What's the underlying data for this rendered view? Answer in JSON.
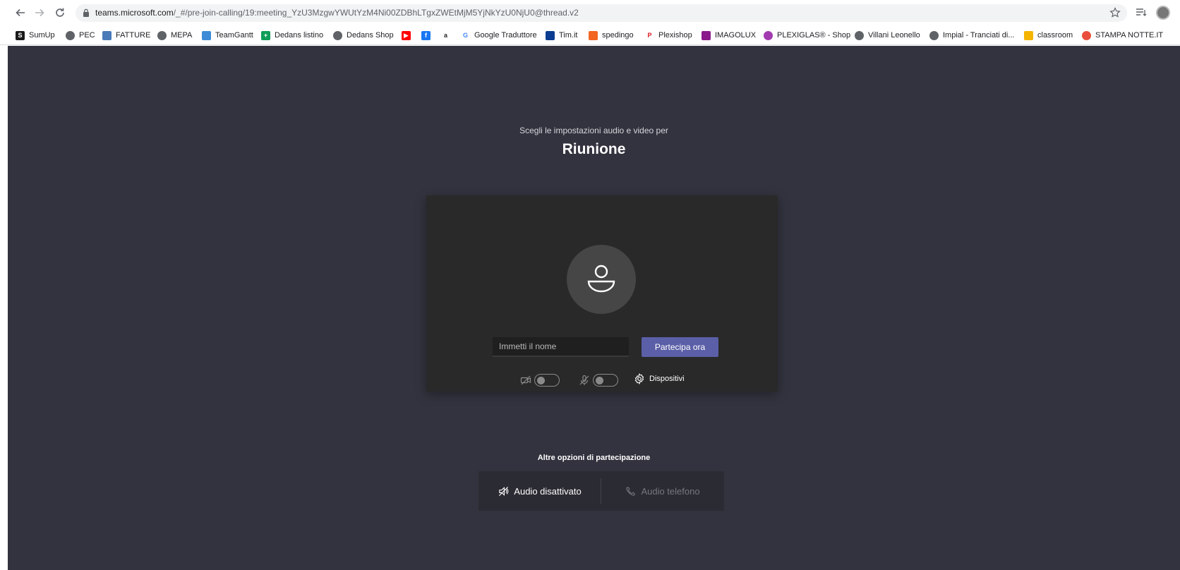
{
  "browser": {
    "url_host": "teams.microsoft.com",
    "url_path": "/_#/pre-join-calling/19:meeting_YzU3MzgwYWUtYzM4Ni00ZDBhLTgxZWEtMjM5YjNkYzU0NjU0@thread.v2",
    "icons": [
      "back-arrow-icon",
      "forward-arrow-icon",
      "reload-icon",
      "lock-icon",
      "star-icon",
      "reading-list-icon",
      "profile-avatar-icon"
    ]
  },
  "bookmarks": [
    {
      "label": "SumUp",
      "icon": "sumup-icon",
      "color": "#1a1a1a"
    },
    {
      "label": "PEC",
      "icon": "globe-icon",
      "color": "#5f6368"
    },
    {
      "label": "FATTURE",
      "icon": "invoice-icon",
      "color": "#4a7ab8"
    },
    {
      "label": "MEPA",
      "icon": "globe-icon",
      "color": "#5f6368"
    },
    {
      "label": "TeamGantt",
      "icon": "teamgantt-icon",
      "color": "#3d8bd6"
    },
    {
      "label": "Dedans listino",
      "icon": "sheets-icon",
      "color": "#0f9d58"
    },
    {
      "label": "Dedans Shop",
      "icon": "globe-icon",
      "color": "#5f6368"
    },
    {
      "label": "",
      "icon": "youtube-icon",
      "color": "#ff0000"
    },
    {
      "label": "",
      "icon": "facebook-icon",
      "color": "#1877f2"
    },
    {
      "label": "",
      "icon": "amazon-icon",
      "color": "#ff9900"
    },
    {
      "label": "Google Traduttore",
      "icon": "google-icon",
      "color": "#4285f4"
    },
    {
      "label": "Tim.it",
      "icon": "tim-icon",
      "color": "#0a3d91"
    },
    {
      "label": "spedingo",
      "icon": "truck-icon",
      "color": "#f26522"
    },
    {
      "label": "Plexishop",
      "icon": "plexishop-icon",
      "color": "#d71920"
    },
    {
      "label": "IMAGOLUX",
      "icon": "imagolux-icon",
      "color": "#8b1a8b"
    },
    {
      "label": "PLEXIGLAS® - Shop",
      "icon": "plexiglas-icon",
      "color": "#a23bb0"
    },
    {
      "label": "Villani Leonello",
      "icon": "globe-icon",
      "color": "#5f6368"
    },
    {
      "label": "Impial - Tranciati di...",
      "icon": "globe-icon",
      "color": "#5f6368"
    },
    {
      "label": "classroom",
      "icon": "classroom-icon",
      "color": "#f4b400"
    },
    {
      "label": "STAMPA NOTTE.IT",
      "icon": "stampanotte-icon",
      "color": "#e94e3c"
    }
  ],
  "prejoin": {
    "subtitle": "Scegli le impostazioni audio e video per",
    "title": "Riunione",
    "name_placeholder": "Immetti il nome",
    "join_label": "Partecipa ora",
    "video_toggle_on": false,
    "mic_toggle_on": false,
    "devices_label": "Dispositivi",
    "accent_color": "#5b5fa7"
  },
  "other_options": {
    "title": "Altre opzioni di partecipazione",
    "audio_off_label": "Audio disattivato",
    "phone_audio_label": "Audio telefono"
  }
}
